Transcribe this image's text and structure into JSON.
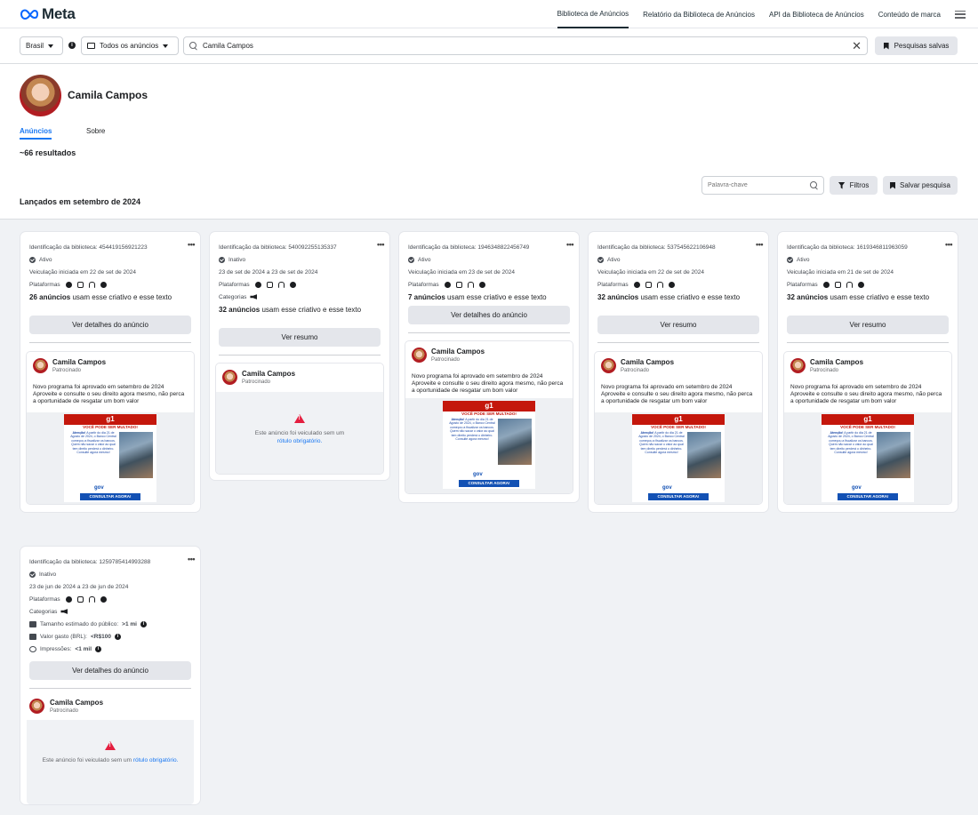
{
  "brand": {
    "logo_text": "Meta"
  },
  "nav": {
    "links": [
      "Biblioteca de Anúncios",
      "Relatório da Biblioteca de Anúncios",
      "API da Biblioteca de Anúncios",
      "Conteúdo de marca"
    ]
  },
  "search": {
    "country": "Brasil",
    "ad_type": "Todos os anúncios",
    "query": "Camila Campos",
    "saved_label": "Pesquisas salvas"
  },
  "profile": {
    "name": "Camila Campos",
    "tabs": [
      "Anúncios",
      "Sobre"
    ],
    "results": "~66 resultados"
  },
  "filters": {
    "keyword_placeholder": "Palavra-chave",
    "filters_label": "Filtros",
    "save_label": "Salvar pesquisa"
  },
  "section_title": "Lançados em setembro de 2024",
  "labels": {
    "platforms": "Plataformas",
    "categories": "Categorias",
    "sponsored": "Patrocinado",
    "missing_text": "Este anúncio foi veiculado sem um",
    "missing_link": "rótulo obrigatório."
  },
  "creative": {
    "brand": "g1",
    "headline": "VOCÊ PODE SER MULTADO!",
    "attention": "Atenção!",
    "body": "A partir do dia 21 de Agosto de 2024, o Banco Central começou a fiscalizar os bancos. Quem não sacar o valor ao qual tem direito perderá o dinheiro. Consulte agora mesmo!",
    "logo": "gov",
    "cta": "CONSULTAR AGORA!"
  },
  "cards": [
    {
      "id": "Identificação da biblioteca: 454419156921223",
      "status": "Ativo",
      "date": "Veiculação iniciada em 22 de set de 2024",
      "count": "26 anúncios",
      "uses": " usam esse criativo e esse texto",
      "button": "Ver detalhes do anúncio",
      "advertiser": "Camila Campos",
      "text": "Novo programa foi aprovado em setembro de 2024 Aproveite e consulte o seu direito agora mesmo, não perca a oportunidade de resgatar um bom valor"
    },
    {
      "id": "Identificação da biblioteca: 540092255135337",
      "status": "Inativo",
      "date": "23 de set de 2024 a 23 de set de 2024",
      "count": "32 anúncios",
      "uses": " usam esse criativo e esse texto",
      "button": "Ver resumo",
      "advertiser": "Camila Campos"
    },
    {
      "id": "Identificação da biblioteca: 1946348822456749",
      "status": "Ativo",
      "date": "Veiculação iniciada em 23 de set de 2024",
      "count": "7 anúncios",
      "uses": " usam esse criativo e esse texto",
      "button": "Ver detalhes do anúncio",
      "advertiser": "Camila Campos",
      "text": "Novo programa foi aprovado em setembro de 2024 Aproveite e consulte o seu direito agora mesmo, não perca a oportunidade de resgatar um bom valor"
    },
    {
      "id": "Identificação da biblioteca: 537545622106948",
      "status": "Ativo",
      "date": "Veiculação iniciada em 22 de set de 2024",
      "count": "32 anúncios",
      "uses": " usam esse criativo e esse texto",
      "button": "Ver resumo",
      "advertiser": "Camila Campos",
      "text": "Novo programa foi aprovado em setembro de 2024 Aproveite e consulte o seu direito agora mesmo, não perca a oportunidade de resgatar um bom valor"
    },
    {
      "id": "Identificação da biblioteca: 1619346811963059",
      "status": "Ativo",
      "date": "Veiculação iniciada em 21 de set de 2024",
      "count": "32 anúncios",
      "uses": " usam esse criativo e esse texto",
      "button": "Ver resumo",
      "advertiser": "Camila Campos",
      "text": "Novo programa foi aprovado em setembro de 2024 Aproveite e consulte o seu direito agora mesmo, não perca a oportunidade de resgatar um bom valor"
    },
    {
      "id": "Identificação da biblioteca: 1259785414993288",
      "status": "Inativo",
      "date": "23 de jun de 2024 a 23 de jun de 2024",
      "button": "Ver detalhes do anúncio",
      "advertiser": "Camila Campos",
      "audience_label": "Tamanho estimado do público: ",
      "audience_value": ">1 mi",
      "spend_label": "Valor gasto (BRL): ",
      "spend_value": "<R$100",
      "impressions_label": "Impressões: ",
      "impressions_value": "<1 mil"
    }
  ],
  "colors": {
    "accent": "#1877f2",
    "g1_red": "#c4170c",
    "cta_blue": "#1351b4",
    "warning": "#e41e3f"
  }
}
